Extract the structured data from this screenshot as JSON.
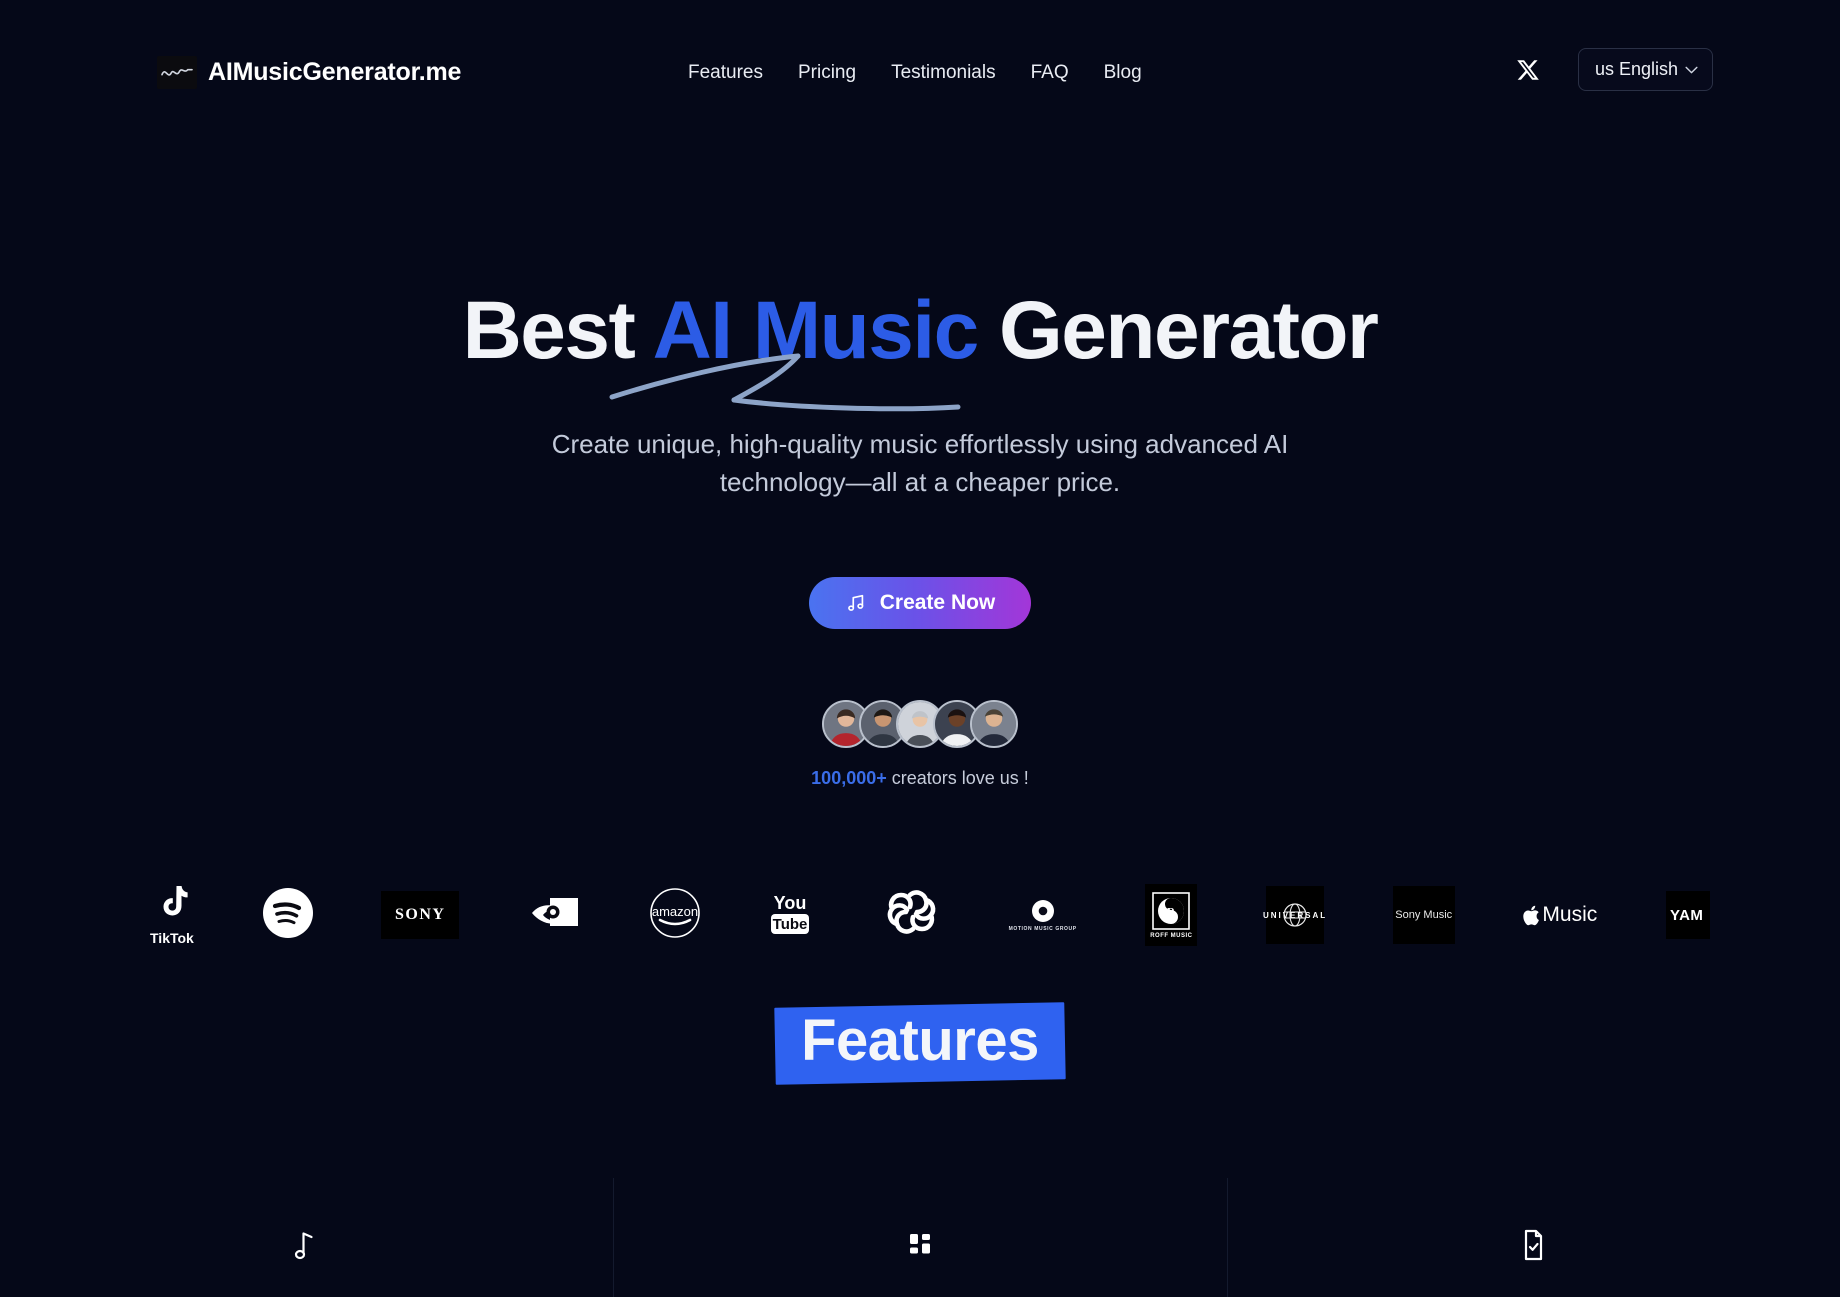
{
  "theme": {
    "background": "#050818",
    "accent_blue": "#2c5ce6",
    "badge_blue": "#2f62f0",
    "text_primary": "#f2f4f8",
    "text_muted": "#c3cada",
    "cta_gradient_from": "#4a73f0",
    "cta_gradient_to": "#a336d8"
  },
  "header": {
    "brand": {
      "name": "AIMusicGenerator.me",
      "mark_icon": "waveform-icon"
    },
    "nav": [
      {
        "label": "Features"
      },
      {
        "label": "Pricing"
      },
      {
        "label": "Testimonials"
      },
      {
        "label": "FAQ"
      },
      {
        "label": "Blog"
      }
    ],
    "social": {
      "icon": "x-twitter-icon"
    },
    "language": {
      "label": "us English",
      "chevron_icon": "chevron-down-icon"
    }
  },
  "hero": {
    "title_part1": "Best ",
    "title_highlight": "AI Music",
    "title_part3": " Generator",
    "subtitle_line1": "Create unique, high-quality music effortlessly using advanced AI",
    "subtitle_line2": "technology—all at a cheaper price.",
    "cta": {
      "label": "Create Now",
      "icon": "music-note-icon"
    },
    "social_proof": {
      "count": "100,000+",
      "text": " creators love us !"
    },
    "avatars": [
      {
        "name": "avatar-1"
      },
      {
        "name": "avatar-2"
      },
      {
        "name": "avatar-3"
      },
      {
        "name": "avatar-4"
      },
      {
        "name": "avatar-5"
      }
    ]
  },
  "logos": [
    {
      "name": "TikTok",
      "icon": "tiktok-logo"
    },
    {
      "name": "Spotify",
      "icon": "spotify-logo"
    },
    {
      "name": "SONY",
      "icon": "sony-logo"
    },
    {
      "name": "NVIDIA",
      "icon": "nvidia-logo"
    },
    {
      "name": "amazon",
      "icon": "amazon-logo"
    },
    {
      "name": "YouTube",
      "icon": "youtube-logo"
    },
    {
      "name": "OpenAI",
      "icon": "openai-logo"
    },
    {
      "name": "MOTION MUSIC GROUP",
      "icon": "motion-music-group-logo"
    },
    {
      "name": "ROFF MUSIC",
      "icon": "roff-music-logo"
    },
    {
      "name": "UNIVERSAL",
      "icon": "universal-logo"
    },
    {
      "name": "Sony Music",
      "icon": "sony-music-logo"
    },
    {
      "name": "Music",
      "icon": "apple-music-logo"
    },
    {
      "name": "YAM",
      "icon": "yamaha-logo"
    }
  ],
  "features": {
    "heading": "Features",
    "columns": [
      {
        "icon": "music-note-icon"
      },
      {
        "icon": "grid-dashboard-icon"
      },
      {
        "icon": "document-check-icon"
      }
    ]
  }
}
